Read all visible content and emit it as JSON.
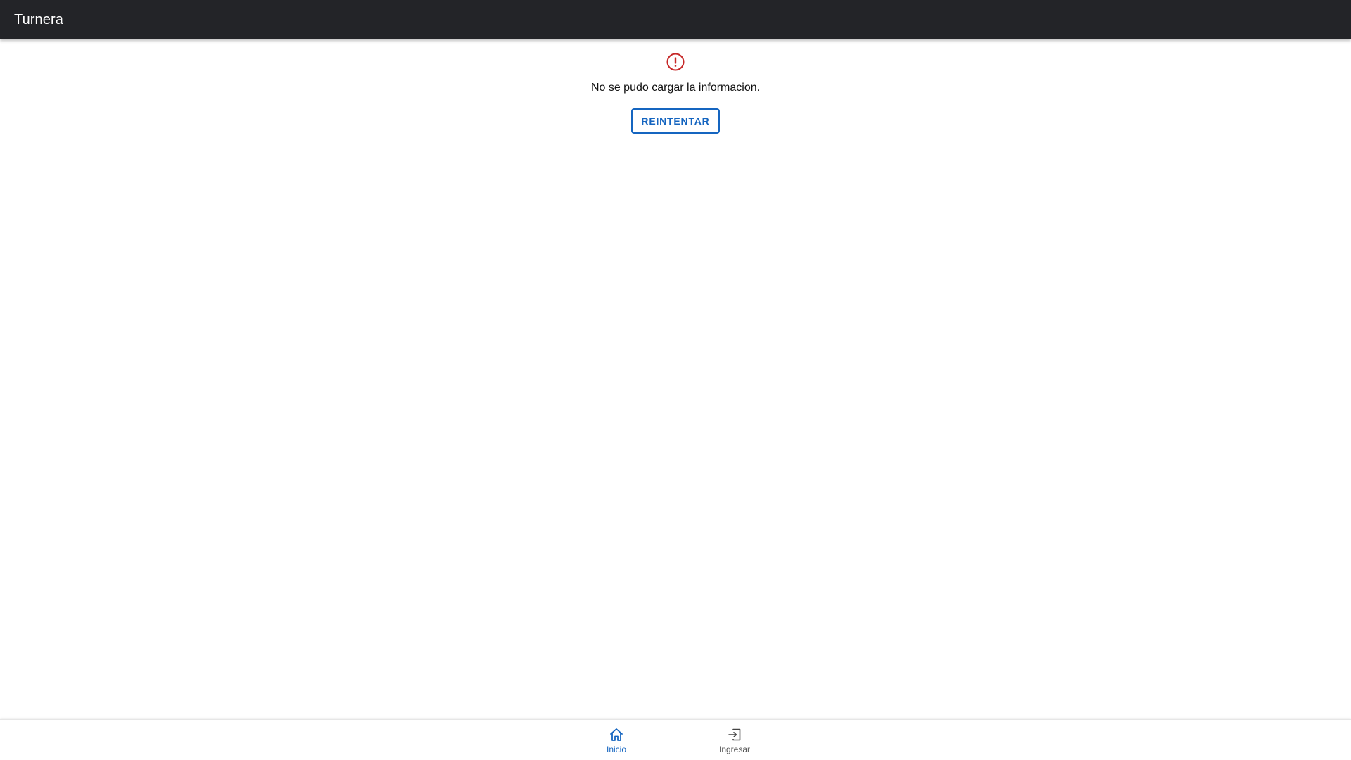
{
  "app": {
    "title": "Turnera"
  },
  "error": {
    "icon": "error-circle-icon",
    "message": "No se pudo cargar la informacion.",
    "retry_label": "REINTENTAR"
  },
  "bottom_nav": {
    "items": [
      {
        "label": "Inicio",
        "icon": "home-icon",
        "active": true
      },
      {
        "label": "Ingresar",
        "icon": "login-icon",
        "active": false
      }
    ]
  },
  "colors": {
    "topbar_bg": "#232428",
    "accent": "#1565c0",
    "error": "#c62828",
    "inactive": "#555555"
  }
}
